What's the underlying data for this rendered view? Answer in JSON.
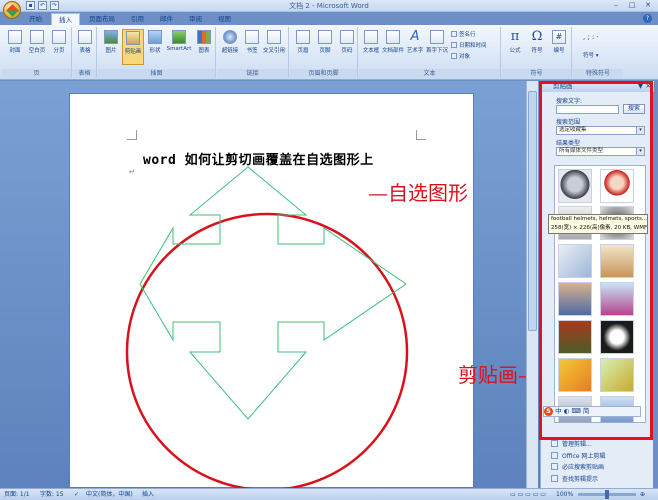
{
  "window": {
    "title": "文档 2 - Microsoft Word"
  },
  "tabs": [
    "开始",
    "插入",
    "页面布局",
    "引用",
    "邮件",
    "审阅",
    "视图"
  ],
  "active_tab": "插入",
  "ribbon": {
    "pages_group": {
      "caption": "页",
      "buttons": [
        "封面",
        "空白页",
        "分页"
      ]
    },
    "tables_group": {
      "caption": "表格",
      "buttons": [
        "表格"
      ]
    },
    "illustrations_group": {
      "caption": "插图",
      "buttons": [
        "图片",
        "剪贴画",
        "形状",
        "SmartArt",
        "图表"
      ]
    },
    "links_group": {
      "caption": "链接",
      "buttons": [
        "超链接",
        "书签",
        "交叉引用"
      ]
    },
    "header_group": {
      "caption": "页眉和页脚",
      "buttons": [
        "页眉",
        "页脚",
        "页码"
      ]
    },
    "text_group": {
      "caption": "文本",
      "buttons": [
        "文本框",
        "文档部件",
        "艺术字",
        "首字下沉"
      ],
      "small": [
        "签名行",
        "日期和时间",
        "对象"
      ]
    },
    "symbols_group": {
      "caption": "符号",
      "buttons": [
        "公式",
        "符号",
        "编号"
      ]
    },
    "special_group": {
      "caption": "特殊符号",
      "buttons": [
        "符号"
      ]
    }
  },
  "document": {
    "heading": "word 如何让剪切画覆盖在自选图形上",
    "para_mark": "↵"
  },
  "annotations": {
    "shape_label": "—自选图形",
    "clipart_label": "剪贴画—"
  },
  "clipart_pane": {
    "title": "剪贴画",
    "search_label": "搜索文字:",
    "search_value": "",
    "search_button": "搜索",
    "scope_label": "搜索范围",
    "scope_value": "选定收藏集",
    "type_label": "结果类型",
    "type_value": "所有媒体文件类型",
    "tooltip_line1": "football helmets, helmets, sports...",
    "tooltip_line2": "258(宽) × 226(高)像素, 20 KB, WMF",
    "ime_text": "中  ◐  ⌨  简",
    "links": [
      "管理剪辑...",
      "Office 网上剪辑",
      "必应搜索剪贴画",
      "查找剪辑提示"
    ]
  },
  "status": {
    "page": "页面: 1/1",
    "words": "字数: 15",
    "language": "中文(简体，中国)",
    "mode": "插入",
    "zoom": "100%"
  },
  "colors": {
    "annotation_red": "#d8121b",
    "arrow_green": "#3fbf7a",
    "accent_blue": "#15428b"
  }
}
